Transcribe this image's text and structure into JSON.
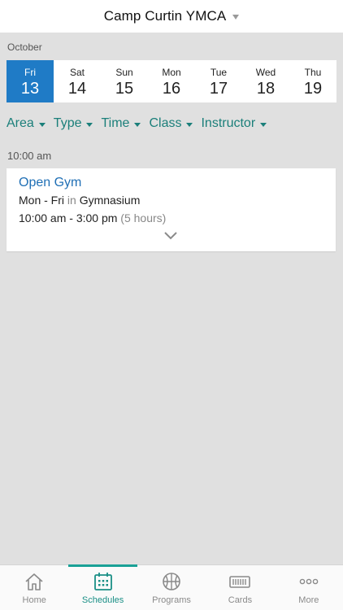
{
  "header": {
    "title": "Camp Curtin YMCA"
  },
  "calendar": {
    "month": "October",
    "days": [
      {
        "dow": "Fri",
        "num": "13",
        "selected": true
      },
      {
        "dow": "Sat",
        "num": "14"
      },
      {
        "dow": "Sun",
        "num": "15"
      },
      {
        "dow": "Mon",
        "num": "16"
      },
      {
        "dow": "Tue",
        "num": "17"
      },
      {
        "dow": "Wed",
        "num": "18"
      },
      {
        "dow": "Thu",
        "num": "19"
      }
    ]
  },
  "filters": [
    "Area",
    "Type",
    "Time",
    "Class",
    "Instructor"
  ],
  "schedule": {
    "time_heading": "10:00 am",
    "event": {
      "title": "Open Gym",
      "days": "Mon - Fri",
      "in_word": "in",
      "location": "Gymnasium",
      "time_range": "10:00 am - 3:00 pm",
      "duration": "(5 hours)"
    }
  },
  "tabs": [
    {
      "label": "Home",
      "icon": "home-icon"
    },
    {
      "label": "Schedules",
      "icon": "calendar-icon",
      "active": true
    },
    {
      "label": "Programs",
      "icon": "basketball-icon"
    },
    {
      "label": "Cards",
      "icon": "card-icon"
    },
    {
      "label": "More",
      "icon": "more-icon"
    }
  ],
  "colors": {
    "accent_teal": "#1aa196",
    "selected_day_blue": "#1f7bc6",
    "event_title_blue": "#1f6fb5",
    "filter_teal": "#1b7f7a",
    "background": "#e0e0e0"
  }
}
